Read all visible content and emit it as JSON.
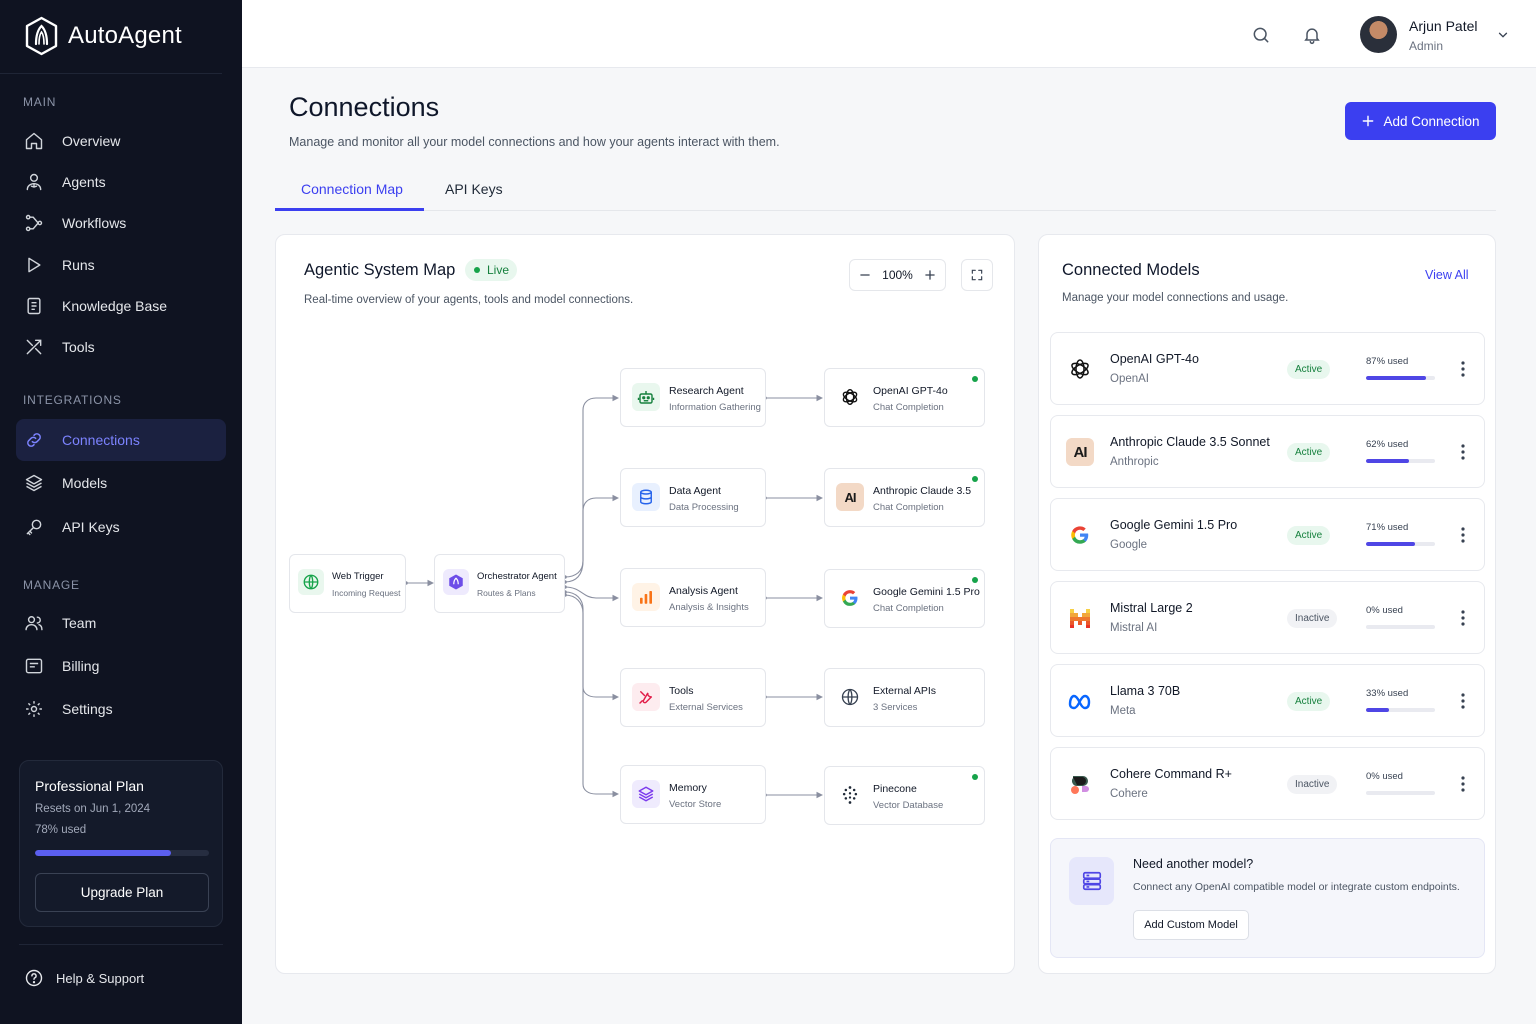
{
  "brand": {
    "name": "AutoAgent"
  },
  "sidebar": {
    "sections": {
      "main": "MAIN",
      "integrations": "INTEGRATIONS",
      "manage": "MANAGE"
    },
    "items": [
      {
        "label": "Overview",
        "icon": "home-icon"
      },
      {
        "label": "Agents",
        "icon": "agent-icon"
      },
      {
        "label": "Workflows",
        "icon": "workflow-icon"
      },
      {
        "label": "Runs",
        "icon": "play-icon"
      },
      {
        "label": "Knowledge Base",
        "icon": "book-icon"
      },
      {
        "label": "Tools",
        "icon": "tools-icon"
      },
      {
        "label": "Connections",
        "icon": "link-icon",
        "active": true
      },
      {
        "label": "Models",
        "icon": "layers-icon"
      },
      {
        "label": "API Keys",
        "icon": "key-icon"
      },
      {
        "label": "Team",
        "icon": "team-icon"
      },
      {
        "label": "Billing",
        "icon": "billing-icon"
      },
      {
        "label": "Settings",
        "icon": "gear-icon"
      }
    ],
    "plan": {
      "title": "Professional Plan",
      "resets": "Resets on Jun 1, 2024",
      "usage_label": "78% used",
      "usage": 0.78,
      "button": "Upgrade Plan"
    },
    "help": "Help & Support"
  },
  "user": {
    "name": "Arjun Patel",
    "role": "Admin"
  },
  "page": {
    "title": "Connections",
    "subtitle": "Manage and monitor all your model connections and how your agents interact with them.",
    "add_button": "Add Connection",
    "tabs": [
      "Connection Map",
      "API Keys"
    ]
  },
  "map": {
    "title": "Agentic System Map",
    "live": "Live",
    "subtitle": "Real-time overview of your agents, tools and model connections.",
    "zoom": "100%",
    "nodes": {
      "trigger": {
        "title": "Web Trigger",
        "sub": "Incoming Request"
      },
      "orchestrator": {
        "title": "Orchestrator Agent",
        "sub": "Routes & Plans"
      },
      "agents": [
        {
          "title": "Research Agent",
          "sub": "Information Gathering"
        },
        {
          "title": "Data Agent",
          "sub": "Data Processing"
        },
        {
          "title": "Analysis Agent",
          "sub": "Analysis & Insights"
        },
        {
          "title": "Tools",
          "sub": "External Services"
        },
        {
          "title": "Memory",
          "sub": "Vector Store"
        }
      ],
      "targets": [
        {
          "title": "OpenAI GPT-4o",
          "sub": "Chat Completion",
          "live": true
        },
        {
          "title": "Anthropic Claude 3.5",
          "sub": "Chat Completion",
          "live": true
        },
        {
          "title": "Google Gemini 1.5 Pro",
          "sub": "Chat Completion",
          "live": true
        },
        {
          "title": "External APIs",
          "sub": "3 Services",
          "live": false
        },
        {
          "title": "Pinecone",
          "sub": "Vector Database",
          "live": true
        }
      ]
    }
  },
  "models": {
    "title": "Connected Models",
    "subtitle": "Manage your model connections and usage.",
    "view_all": "View All",
    "list": [
      {
        "name": "OpenAI GPT-4o",
        "provider": "OpenAI",
        "status": "Active",
        "used_label": "87% used",
        "used": 0.87
      },
      {
        "name": "Anthropic Claude 3.5 Sonnet",
        "provider": "Anthropic",
        "status": "Active",
        "used_label": "62% used",
        "used": 0.62
      },
      {
        "name": "Google Gemini 1.5 Pro",
        "provider": "Google",
        "status": "Active",
        "used_label": "71% used",
        "used": 0.71
      },
      {
        "name": "Mistral Large 2",
        "provider": "Mistral AI",
        "status": "Inactive",
        "used_label": "0% used",
        "used": 0
      },
      {
        "name": "Llama 3 70B",
        "provider": "Meta",
        "status": "Active",
        "used_label": "33% used",
        "used": 0.33
      },
      {
        "name": "Cohere Command R+",
        "provider": "Cohere",
        "status": "Inactive",
        "used_label": "0% used",
        "used": 0
      }
    ],
    "need": {
      "title": "Need another model?",
      "subtitle": "Connect any OpenAI compatible model or integrate custom endpoints.",
      "button": "Add Custom Model"
    }
  },
  "colors": {
    "accent": "#3b3ff0",
    "sidebar_bg": "#0f1321",
    "active_green": "#16a34a"
  }
}
